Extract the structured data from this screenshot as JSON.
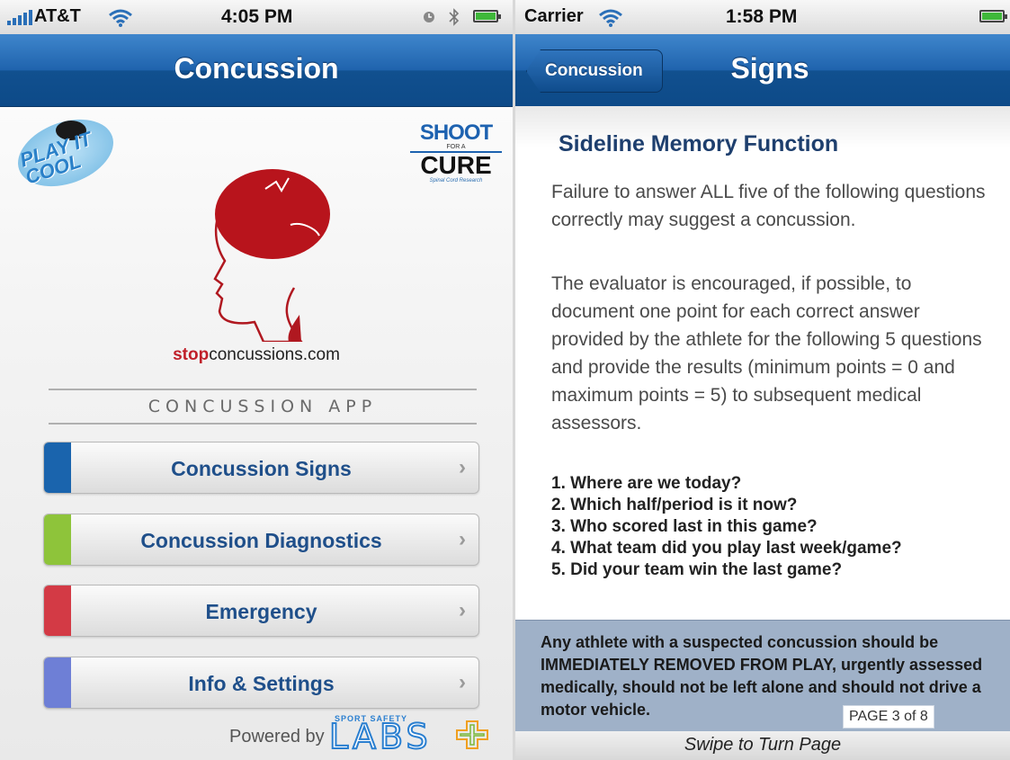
{
  "left": {
    "status": {
      "carrier": "AT&T",
      "time": "4:05 PM"
    },
    "nav_title": "Concussion",
    "puck_logo_text": "PLAY IT COOL",
    "stc_logo": {
      "line1": "SHOOT",
      "line2": "FOR A",
      "line3": "CURE",
      "tagline": "Spinal Cord Research"
    },
    "site": {
      "stop": "stop",
      "rest": "concussions.com"
    },
    "app_banner": "CONCUSSION APP",
    "menu": [
      {
        "label": "Concussion Signs",
        "color": "#1a64ad"
      },
      {
        "label": "Concussion Diagnostics",
        "color": "#8ec43a"
      },
      {
        "label": "Emergency",
        "color": "#d33a45"
      },
      {
        "label": "Info & Settings",
        "color": "#6e7fd6"
      }
    ],
    "powered_by": "Powered by",
    "ssl_logo": {
      "small": "SPORT SAFETY",
      "big": "LABS"
    }
  },
  "right": {
    "status": {
      "carrier": "Carrier",
      "time": "1:58 PM"
    },
    "back_label": "Concussion",
    "nav_title": "Signs",
    "section_title": "Sideline Memory Function",
    "paragraph1": "Failure to answer ALL five of the following questions correctly may suggest a concussion.",
    "paragraph2": "The evaluator is encouraged, if possible, to document one point for each correct answer provided by the athlete for the following 5 questions and provide the results (minimum points = 0 and maximum points = 5) to subsequent medical assessors.",
    "questions": [
      "1. Where are we today?",
      "2. Which half/period is it now?",
      "3. Who scored last in this game?",
      "4. What team did you play last week/game?",
      "5. Did your team win the last game?"
    ],
    "warning": "Any athlete with a suspected concussion should be IMMEDIATELY REMOVED FROM PLAY, urgently assessed medically, should not be left alone and should not drive a motor vehicle.",
    "page_indicator": "PAGE 3 of 8",
    "swipe_hint": "Swipe to Turn Page"
  },
  "colors": {
    "nav_blue": "#1f63ad",
    "accent_red": "#c0202a",
    "warning_bg": "#9fb1c8"
  },
  "icons": [
    "signal-bars-icon",
    "wifi-icon",
    "clock-icon",
    "bluetooth-icon",
    "battery-icon",
    "chevron-right-icon"
  ]
}
